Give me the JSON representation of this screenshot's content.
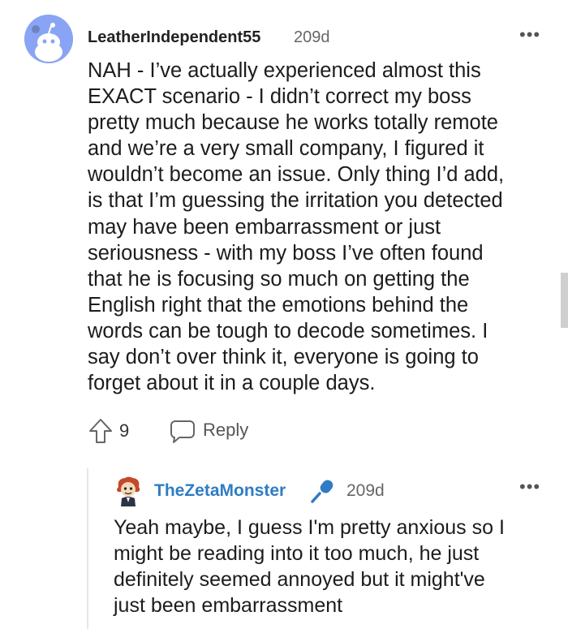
{
  "comment": {
    "username": "LeatherIndependent55",
    "age": "209d",
    "more_label": "•••",
    "avatar_icon": "reddit-snoo-avatar-icon",
    "lines": [
      "NAH - I’ve actually experienced almost this",
      "EXACT scenario - I didn’t correct my boss",
      "pretty much because he works totally remote",
      "and we’re a very small company, I figured it",
      "wouldn’t become an issue. Only thing I’d add,",
      "is that I’m guessing the irritation you detected",
      "may have been embarrassment or just",
      "seriousness - with my boss I’ve often found",
      "that he is focusing so much on getting the",
      "English right that the emotions behind the",
      "words can be tough to decode sometimes. I",
      "say don’t over think it, everyone is going to",
      "forget about it in a couple days."
    ],
    "vote_count": "9",
    "reply_label": "Reply"
  },
  "reply": {
    "username": "TheZetaMonster",
    "age": "209d",
    "more_label": "•••",
    "avatar_icon": "cartoon-character-avatar-icon",
    "badge_icon": "microphone-icon",
    "lines": [
      "Yeah maybe, I guess I'm pretty anxious so I",
      "might be reading into it too much, he just",
      "definitely seemed annoyed but it might've",
      "just been embarrassment"
    ]
  },
  "colors": {
    "avatar_bg": "#8aa4f5",
    "reply_username": "#2f7cc4",
    "mic_badge": "#2f7cc4"
  }
}
